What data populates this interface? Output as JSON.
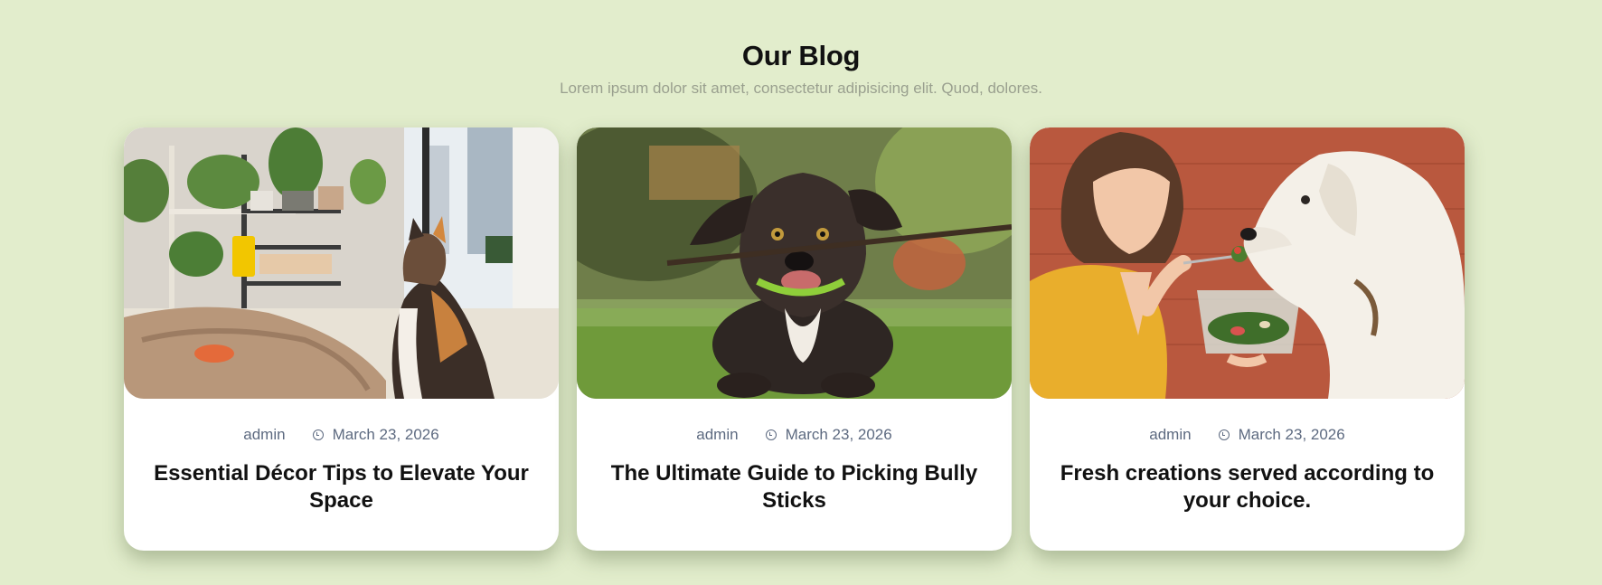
{
  "section": {
    "title": "Our Blog",
    "subtitle": "Lorem ipsum dolor sit amet, consectetur adipisicing elit. Quod, dolores."
  },
  "posts": [
    {
      "author": "admin",
      "date": "March 23, 2026",
      "title": "Essential Décor Tips to Elevate Your Space",
      "image": "cat-in-plant-room"
    },
    {
      "author": "admin",
      "date": "March 23, 2026",
      "title": "The Ultimate Guide to Picking Bully Sticks",
      "image": "puppy-with-stick"
    },
    {
      "author": "admin",
      "date": "March 23, 2026",
      "title": "Fresh creations served according to your choice.",
      "image": "woman-feeding-dog"
    }
  ],
  "colors": {
    "background": "#e2edcc",
    "card": "#ffffff",
    "meta": "#5d6a80",
    "subtitle": "#9aa08f"
  }
}
